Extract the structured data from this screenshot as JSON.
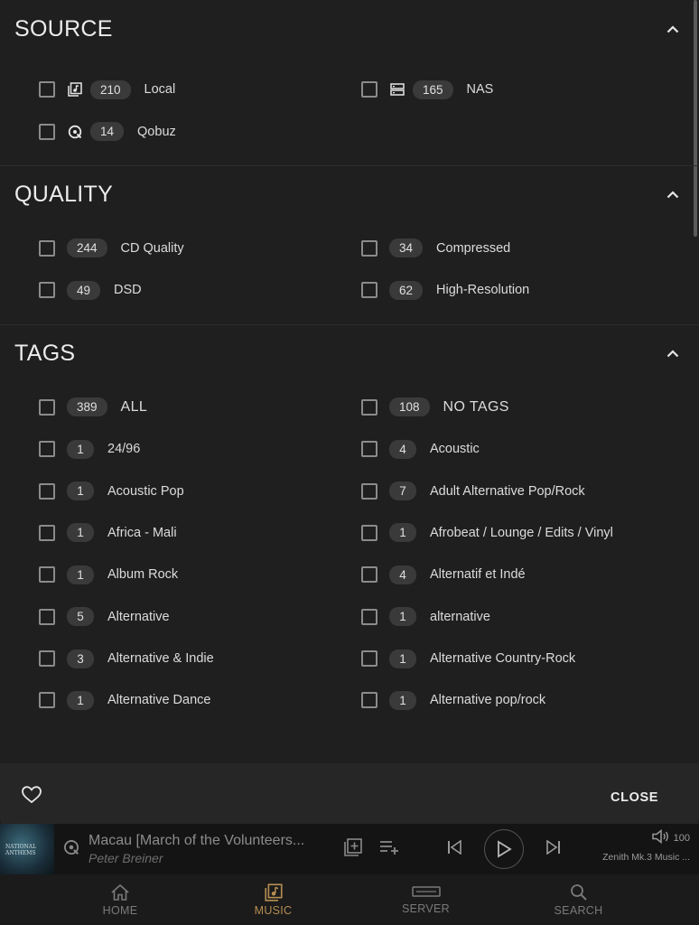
{
  "source": {
    "title": "SOURCE",
    "items": [
      {
        "count": "210",
        "label": "Local",
        "icon": "local-library-icon"
      },
      {
        "count": "165",
        "label": "NAS",
        "icon": "server-icon"
      },
      {
        "count": "14",
        "label": "Qobuz",
        "icon": "qobuz-icon"
      }
    ]
  },
  "quality": {
    "title": "QUALITY",
    "items": [
      {
        "count": "244",
        "label": "CD Quality"
      },
      {
        "count": "34",
        "label": "Compressed"
      },
      {
        "count": "49",
        "label": "DSD"
      },
      {
        "count": "62",
        "label": "High-Resolution"
      }
    ]
  },
  "tags": {
    "title": "TAGS",
    "items": [
      {
        "count": "389",
        "label": "ALL"
      },
      {
        "count": "108",
        "label": "NO TAGS"
      },
      {
        "count": "1",
        "label": "24/96"
      },
      {
        "count": "4",
        "label": "Acoustic"
      },
      {
        "count": "1",
        "label": "Acoustic Pop"
      },
      {
        "count": "7",
        "label": "Adult Alternative Pop/Rock"
      },
      {
        "count": "1",
        "label": "Africa - Mali"
      },
      {
        "count": "1",
        "label": "Afrobeat / Lounge / Edits / Vinyl"
      },
      {
        "count": "1",
        "label": "Album Rock"
      },
      {
        "count": "4",
        "label": "Alternatif et Indé"
      },
      {
        "count": "5",
        "label": "Alternative"
      },
      {
        "count": "1",
        "label": "alternative"
      },
      {
        "count": "3",
        "label": "Alternative & Indie"
      },
      {
        "count": "1",
        "label": "Alternative Country-Rock"
      },
      {
        "count": "1",
        "label": "Alternative Dance"
      },
      {
        "count": "1",
        "label": "Alternative pop/rock"
      }
    ]
  },
  "footer": {
    "close_label": "CLOSE"
  },
  "player": {
    "title": "Macau [March of the Volunteers...",
    "artist": "Peter Breiner",
    "volume": "100",
    "zone": "Zenith Mk.3 Music ...",
    "cover_text": "NATIONAL ANTHEMS"
  },
  "nav": {
    "items": [
      {
        "label": "HOME",
        "icon": "home-icon",
        "active": false
      },
      {
        "label": "MUSIC",
        "icon": "music-library-icon",
        "active": true
      },
      {
        "label": "SERVER",
        "icon": "server-icon",
        "active": false
      },
      {
        "label": "SEARCH",
        "icon": "search-icon",
        "active": false
      }
    ]
  },
  "colors": {
    "background": "#1f1f1f",
    "badge": "#3a3a3a",
    "accent": "#b58d52"
  }
}
